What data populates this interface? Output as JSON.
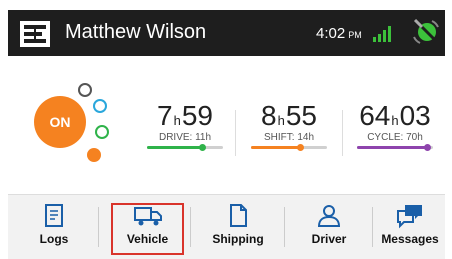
{
  "header": {
    "user_name": "Matthew Wilson",
    "time": "4:02",
    "ampm": "PM",
    "icons": [
      "eld-logo-icon",
      "signal-strength-icon",
      "satellite-icon"
    ],
    "colors": {
      "bar": "#1e1e1e",
      "signal": "#3cc13b"
    }
  },
  "status": {
    "label": "ON",
    "color": "#f58220"
  },
  "stats": [
    {
      "hours": "7",
      "h_unit": "h",
      "minutes": "59",
      "label": "DRIVE: 11h",
      "progress": 0.73,
      "color": "#2fb34a"
    },
    {
      "hours": "8",
      "h_unit": "h",
      "minutes": "55",
      "label": "SHIFT: 14h",
      "progress": 0.64,
      "color": "#f58220"
    },
    {
      "hours": "64",
      "h_unit": "h",
      "minutes": "03",
      "label": "CYCLE: 70h",
      "progress": 0.92,
      "color": "#8e44ad"
    }
  ],
  "tabs": [
    {
      "label": "Logs",
      "icon": "logs-icon",
      "selected": false
    },
    {
      "label": "Vehicle",
      "icon": "truck-icon",
      "selected": true
    },
    {
      "label": "Shipping",
      "icon": "document-icon",
      "selected": false
    },
    {
      "label": "Driver",
      "icon": "user-icon",
      "selected": false
    },
    {
      "label": "Messages",
      "icon": "messages-icon",
      "selected": false
    }
  ]
}
